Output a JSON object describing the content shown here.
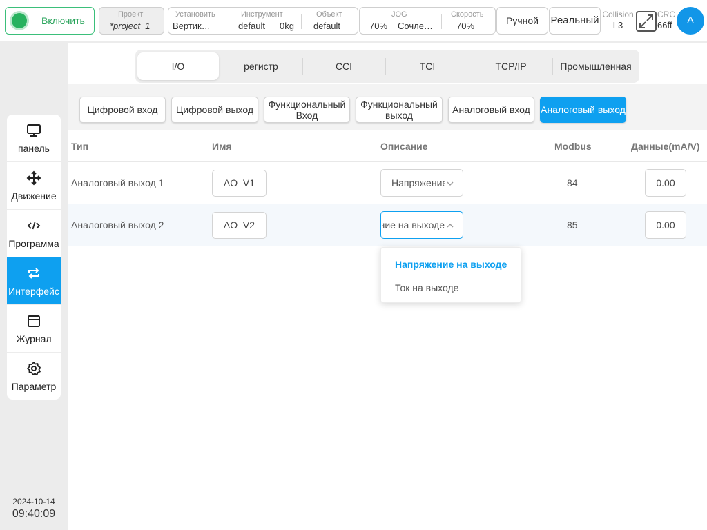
{
  "topbar": {
    "power_label": "Включить",
    "project": {
      "caption": "Проект",
      "value": "*project_1"
    },
    "install": {
      "caption": "Установить",
      "value": "Вертик…"
    },
    "tool": {
      "caption": "Инструмент",
      "value": "default",
      "weight": "0kg"
    },
    "object": {
      "caption": "Объект",
      "value": "default"
    },
    "jog": {
      "caption": "JOG",
      "percent": "70%",
      "mode": "Сочле…"
    },
    "speed": {
      "caption": "Скорость",
      "value": "70%"
    },
    "manual_label": "Ручной",
    "real_label": "Реальный",
    "collision": {
      "caption": "Collision",
      "value": "L3"
    },
    "crc": {
      "caption": "CRC",
      "value": "66ff"
    },
    "avatar_letter": "A",
    "colors": {
      "power": "#27b25f",
      "accent": "#0ea0f0"
    }
  },
  "sidebar": {
    "items": [
      {
        "label": "панель",
        "icon": "monitor-icon"
      },
      {
        "label": "Движение",
        "icon": "move-arrows-icon"
      },
      {
        "label": "Программа",
        "icon": "code-icon"
      },
      {
        "label": "Интерфейс",
        "icon": "swap-arrows-icon",
        "active": true
      },
      {
        "label": "Журнал",
        "icon": "calendar-icon"
      },
      {
        "label": "Параметр",
        "icon": "gear-icon"
      }
    ],
    "date": "2024-10-14",
    "time": "09:40:09"
  },
  "tabs": [
    "I/O",
    "регистр",
    "CCI",
    "TCI",
    "TCP/IP",
    "Промышленная"
  ],
  "active_tab": "I/O",
  "subtabs": [
    "Цифровой вход",
    "Цифровой выход",
    "Функциональный Вход",
    "Функциональный выход",
    "Аналоговый вход",
    "Аналоговый выход"
  ],
  "active_subtab": "Аналоговый выход",
  "table": {
    "headers": {
      "type": "Тип",
      "name": "Имя",
      "description": "Описание",
      "modbus": "Modbus",
      "data": "Данные(mA/V)"
    },
    "rows": [
      {
        "type": "Аналоговый выход 1",
        "name": "AO_V1",
        "description": "Напряжение на выходе",
        "modbus": "84",
        "data": "0.00"
      },
      {
        "type": "Аналоговый выход 2",
        "name": "AO_V2",
        "description": "Напряжение на выходе",
        "modbus": "85",
        "data": "0.00"
      }
    ]
  },
  "dropdown": {
    "options": [
      "Напряжение на выходе",
      "Ток на выходе"
    ],
    "selected": "Напряжение на выходе"
  }
}
